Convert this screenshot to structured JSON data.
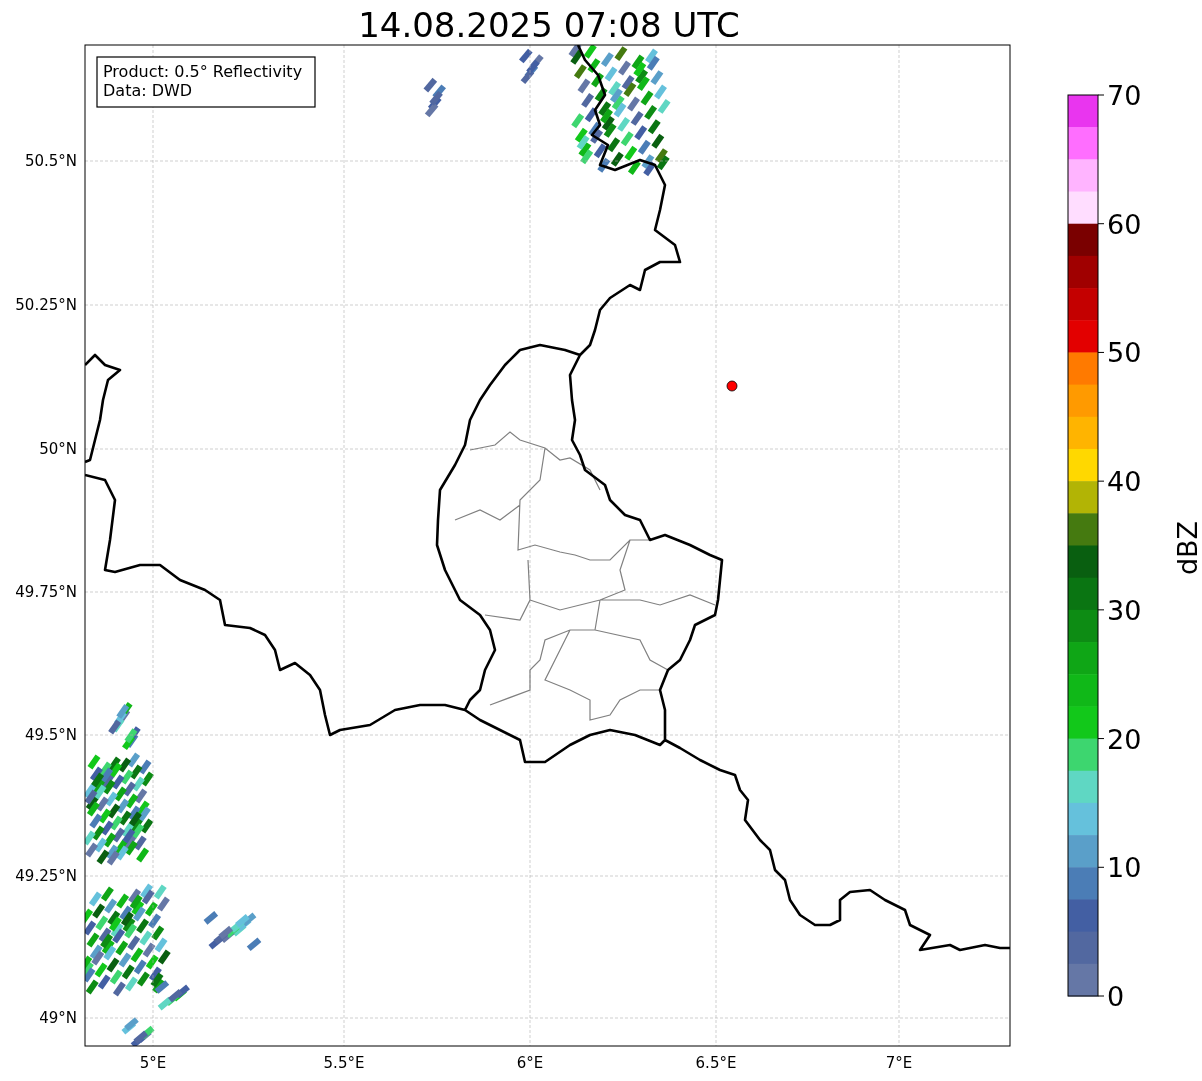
{
  "title": "14.08.2025 07:08 UTC",
  "info_box": [
    "Product: 0.5° Reflectivity",
    "Data: DWD"
  ],
  "x_ticks": [
    "5°E",
    "5.5°E",
    "6°E",
    "6.5°E",
    "7°E"
  ],
  "y_ticks": [
    "50.5°N",
    "50.25°N",
    "50°N",
    "49.75°N",
    "49.5°N",
    "49.25°N",
    "49°N"
  ],
  "colorbar": {
    "label": "dBZ",
    "ticks": [
      "70",
      "60",
      "50",
      "40",
      "30",
      "20",
      "10",
      "0"
    ],
    "bins": [
      {
        "color": "#e935ef"
      },
      {
        "color": "#ff6eff"
      },
      {
        "color": "#ffb4ff"
      },
      {
        "color": "#ffddff"
      },
      {
        "color": "#7a0000"
      },
      {
        "color": "#a00000"
      },
      {
        "color": "#c40000"
      },
      {
        "color": "#e30000"
      },
      {
        "color": "#ff7a00"
      },
      {
        "color": "#ff9a00"
      },
      {
        "color": "#ffb400"
      },
      {
        "color": "#ffd800"
      },
      {
        "color": "#b2b405"
      },
      {
        "color": "#457a10"
      },
      {
        "color": "#095f10"
      },
      {
        "color": "#0a7512"
      },
      {
        "color": "#0d8c14"
      },
      {
        "color": "#0fa616"
      },
      {
        "color": "#10b818"
      },
      {
        "color": "#12c81a"
      },
      {
        "color": "#3dd66f"
      },
      {
        "color": "#5fd7c3"
      },
      {
        "color": "#65c1dc"
      },
      {
        "color": "#5a9fc9"
      },
      {
        "color": "#4b7db6"
      },
      {
        "color": "#435fa3"
      },
      {
        "color": "#5268a0"
      },
      {
        "color": "#6577a6"
      }
    ]
  }
}
